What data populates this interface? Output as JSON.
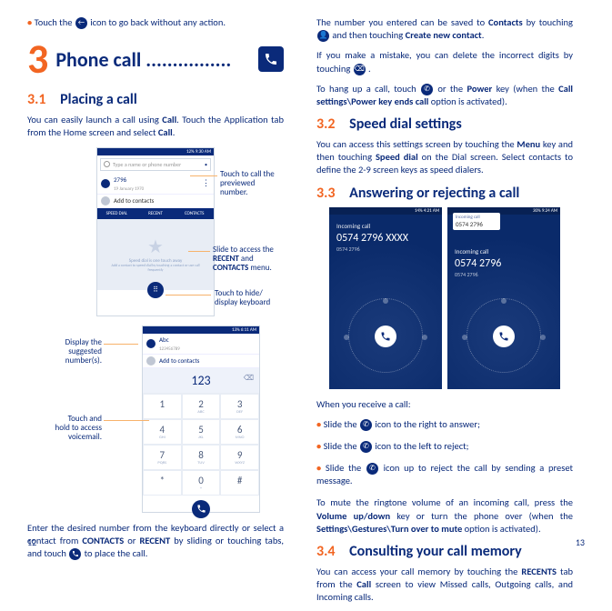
{
  "left": {
    "backTip": "Touch the ",
    "backTipIcon": "back-arrow",
    "backTip2": " icon to go back without any action.",
    "chapterNum": "3",
    "chapterTitle": "Phone call ................",
    "s31num": "3.1",
    "s31title": "Placing a call",
    "p1a": "You can easily launch a call using ",
    "p1b": "Call",
    "p1c": ". Touch the Application tab from the Home screen and select ",
    "p1d": "Call",
    "shot1": {
      "status": "12% 9:30 AM",
      "searchPlaceholder": "Type a name or phone number",
      "contactNum": "2796",
      "contactDate": "19 January 1970",
      "addContacts": "Add to contacts",
      "tab1": "SPEED DIAL",
      "tab2": "RECENT",
      "tab3": "CONTACTS",
      "emptyMsg": "Speed dial is one touch away",
      "emptySub": "Add a contact to speed dial by touching a contact or use call frequently"
    },
    "calloutPreview": "Touch to call the previewed number.",
    "calloutSlide1": "Slide to access the ",
    "calloutSlide2": "RECENT",
    "calloutSlide3": " and ",
    "calloutSlide4": "CONTACTS",
    "calloutSlide5": " menu.",
    "calloutHide": "Touch to hide/ display keyboard",
    "shot2": {
      "status": "13% 6:11 AM",
      "name": "Abc",
      "subnum": "123456789",
      "addContacts": "Add to contacts",
      "typed": "123",
      "keys": [
        "1",
        "2",
        "3",
        "4",
        "5",
        "6",
        "7",
        "8",
        "9",
        "*",
        "0",
        "#"
      ],
      "subs": [
        " ",
        "ABC",
        "DEF",
        "GHI",
        "JKL",
        "MNO",
        "PQRS",
        "TUV",
        "WXYZ",
        " ",
        "+",
        " "
      ]
    },
    "calloutSuggested": "Display the suggested number(s).",
    "calloutVoicemail": "Touch and hold to access voicemail.",
    "p2a": "Enter the desired number from the keyboard directly or select a contact from ",
    "p2b": "CONTACTS",
    "p2c": " or ",
    "p2d": "RECENT",
    "p2e": " by sliding or touching tabs, and touch ",
    "p2f": " to place the call.",
    "pageNum": "12"
  },
  "right": {
    "p1a": "The number you entered can be saved to ",
    "p1b": "Contacts",
    "p1c": " by touching ",
    "p1d": " and then touching ",
    "p1e": "Create new contact",
    "p2a": "If you make a mistake, you can delete the incorrect digits by touching ",
    "p3a": "To hang up a call, touch ",
    "p3b": " or the ",
    "p3c": "Power",
    "p3d": " key (when the ",
    "p3e": "Call settings\\Power key ends call",
    "p3f": " option is activated).",
    "s32num": "3.2",
    "s32title": "Speed dial settings",
    "p4a": "You can access this settings screen by touching the ",
    "p4b": "Menu",
    "p4c": " key and then touching ",
    "p4d": "Speed dial",
    "p4e": " on the Dial screen. Select contacts to define the 2-9 screen keys as speed dialers.",
    "s33num": "3.3",
    "s33title": "Answering or rejecting a call",
    "incoming": {
      "status": "14% 4:21 AM",
      "label": "Incoming call",
      "number1": "0574 2796 XXXX",
      "sub1": "0574 2796",
      "status2": "30% 9:24 AM",
      "number2": "0574 2796",
      "sub2": "0574 2796",
      "miniLabel": "Incoming call",
      "miniNum": "0574 2796"
    },
    "p5": "When you receive a call:",
    "b1a": "Slide the ",
    "b1b": " icon to the right to answer;",
    "b2a": "Slide the ",
    "b2b": " icon to the left to reject;",
    "b3a": "Slide the ",
    "b3b": " icon up to reject the call by sending a preset message.",
    "p6a": "To mute the ringtone volume of an incoming call, press the ",
    "p6b": "Volume up/down",
    "p6c": " key or turn the phone over (when the ",
    "p6d": "Settings\\Gestures\\Turn over to mute",
    "p6e": " option is activated).",
    "s34num": "3.4",
    "s34title": "Consulting your call memory",
    "p7a": "You can access your call memory by touching the ",
    "p7b": "RECENTS",
    "p7c": " tab from the ",
    "p7d": "Call",
    "p7e": " screen to view Missed calls, Outgoing calls, and Incoming calls.",
    "pageNum": "13"
  }
}
